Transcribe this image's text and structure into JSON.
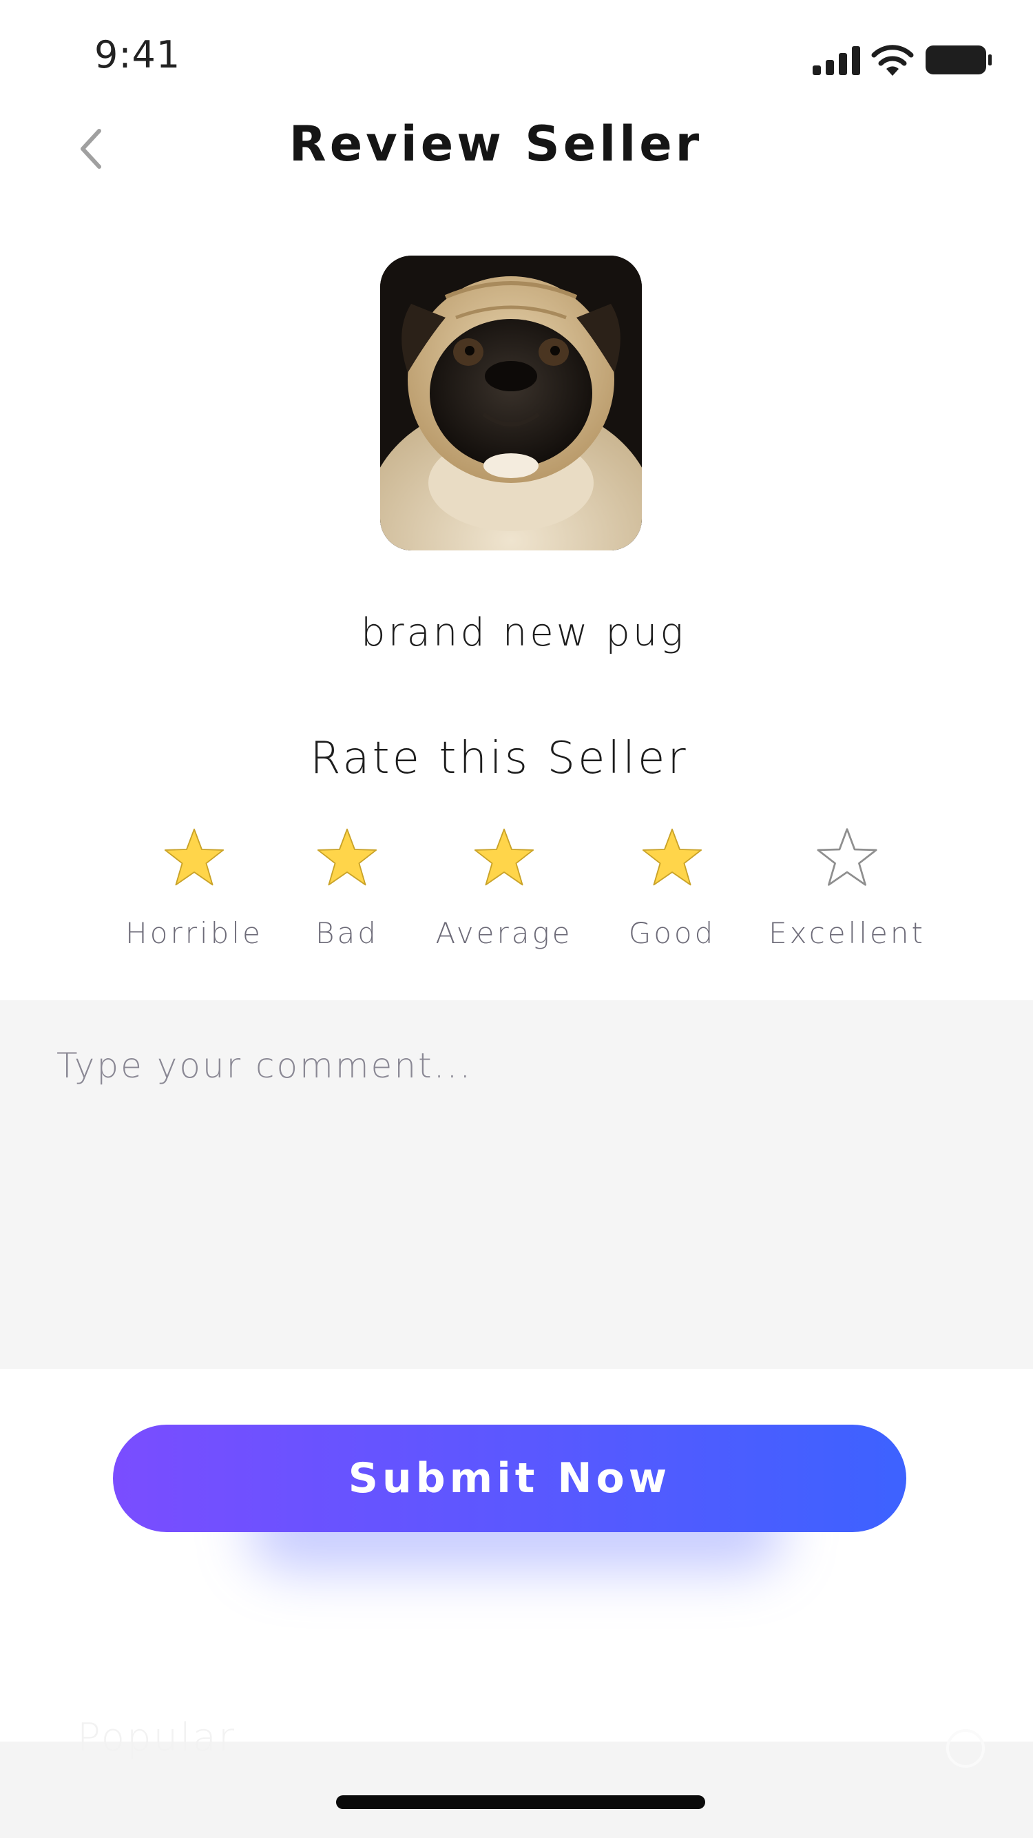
{
  "status_bar": {
    "time": "9:41",
    "signal_icon": "cellular-signal-icon",
    "wifi_icon": "wifi-icon",
    "battery_icon": "battery-icon"
  },
  "nav": {
    "back_icon": "chevron-left-icon",
    "title": "Review Seller"
  },
  "seller": {
    "avatar": "pug-photo",
    "name": "brand new pug"
  },
  "rating": {
    "title": "Rate this Seller",
    "value": 4,
    "max": 5,
    "options": [
      {
        "label": "Horrible",
        "filled": true
      },
      {
        "label": "Bad",
        "filled": true
      },
      {
        "label": "Average",
        "filled": true
      },
      {
        "label": "Good",
        "filled": true
      },
      {
        "label": "Excellent",
        "filled": false
      }
    ],
    "star_color": "#FFD54A",
    "star_outline": "#8f8f8f"
  },
  "comment": {
    "placeholder": "Type your comment...",
    "value": ""
  },
  "submit": {
    "label": "Submit Now",
    "gradient_start": "#7A4DFF",
    "gradient_end": "#3D62FF"
  },
  "tab_bar": {
    "popular_label": "Popular"
  }
}
